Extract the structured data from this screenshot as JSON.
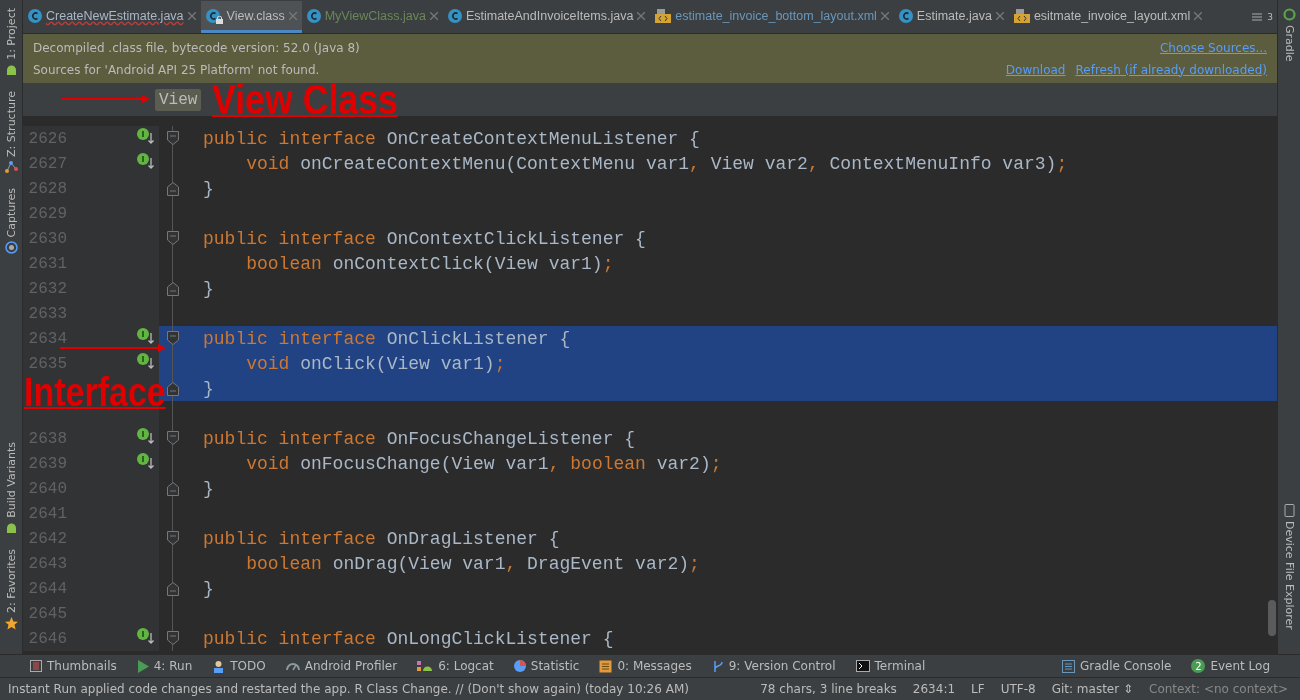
{
  "tabs": [
    {
      "label": "CreateNewEstimate.java",
      "kind": "class",
      "selected": false,
      "error": true,
      "locked": false,
      "color": "#a9b7c6"
    },
    {
      "label": "View.class",
      "kind": "class",
      "selected": true,
      "error": false,
      "locked": true,
      "color": "#bbbbbb"
    },
    {
      "label": "MyViewClass.java",
      "kind": "class",
      "selected": false,
      "error": false,
      "locked": false,
      "color": "#6a8759"
    },
    {
      "label": "EstimateAndInvoiceItems.java",
      "kind": "class",
      "selected": false,
      "error": false,
      "locked": false,
      "color": "#bbbbbb"
    },
    {
      "label": "estimate_invoice_bottom_layout.xml",
      "kind": "xml",
      "selected": false,
      "error": false,
      "locked": false,
      "color": "#6897bb"
    },
    {
      "label": "Estimate.java",
      "kind": "class",
      "selected": false,
      "error": false,
      "locked": false,
      "color": "#bbbbbb"
    },
    {
      "label": "esitmate_invoice_layout.xml",
      "kind": "xml",
      "selected": false,
      "error": false,
      "locked": false,
      "color": "#bbbbbb"
    }
  ],
  "tab_overflow": "3",
  "left_tool_windows": [
    {
      "label": "1: Project",
      "kind": "android"
    },
    {
      "label": "Z: Structure",
      "kind": "structure"
    },
    {
      "label": "Captures",
      "kind": "camera"
    },
    {
      "label": "Build Variants",
      "kind": "android"
    },
    {
      "label": "2: Favorites",
      "kind": "star"
    }
  ],
  "right_tool_windows": [
    {
      "label": "Gradle",
      "kind": "gradle"
    },
    {
      "label": "Device File Explorer",
      "kind": "phone"
    }
  ],
  "banner": {
    "lines": [
      {
        "text": "Decompiled .class file, bytecode version: 52.0 (Java 8)",
        "links": [
          "Choose Sources..."
        ]
      },
      {
        "text": "Sources for 'Android API 25 Platform' not found.",
        "links": [
          "Download",
          "Refresh (if already downloaded)"
        ]
      }
    ]
  },
  "breadcrumb": "View",
  "annotations": [
    {
      "text": "View Class",
      "kind": "title"
    },
    {
      "text": "Interface",
      "kind": "label"
    }
  ],
  "code_lines": [
    {
      "number": "2626",
      "implemented": true,
      "kind": "fold_start",
      "selected": false,
      "tokens": [
        {
          "kind": "keyword",
          "text": "public interface "
        },
        {
          "kind": "name",
          "text": "OnCreateContextMenuListener {"
        }
      ]
    },
    {
      "number": "2627",
      "implemented": true,
      "kind": "plain",
      "selected": false,
      "tokens": [
        {
          "kind": "keyword",
          "text": "    void "
        },
        {
          "kind": "name",
          "text": "onCreateContextMenu(ContextMenu var1"
        },
        {
          "kind": "keyword",
          "text": ", "
        },
        {
          "kind": "name",
          "text": "View var2"
        },
        {
          "kind": "keyword",
          "text": ", "
        },
        {
          "kind": "name",
          "text": "ContextMenuInfo var3)"
        },
        {
          "kind": "keyword",
          "text": ";"
        }
      ]
    },
    {
      "number": "2628",
      "implemented": false,
      "kind": "fold_end",
      "selected": false,
      "tokens": [
        {
          "kind": "name",
          "text": "}"
        }
      ]
    },
    {
      "number": "2629",
      "implemented": false,
      "kind": "plain",
      "selected": false
    },
    {
      "number": "2630",
      "implemented": false,
      "kind": "fold_start",
      "selected": false,
      "tokens": [
        {
          "kind": "keyword",
          "text": "public interface "
        },
        {
          "kind": "name",
          "text": "OnContextClickListener {"
        }
      ]
    },
    {
      "number": "2631",
      "implemented": false,
      "kind": "plain",
      "selected": false,
      "tokens": [
        {
          "kind": "keyword",
          "text": "    boolean "
        },
        {
          "kind": "name",
          "text": "onContextClick(View var1)"
        },
        {
          "kind": "keyword",
          "text": ";"
        }
      ]
    },
    {
      "number": "2632",
      "implemented": false,
      "kind": "fold_end",
      "selected": false,
      "tokens": [
        {
          "kind": "name",
          "text": "}"
        }
      ]
    },
    {
      "number": "2633",
      "implemented": false,
      "kind": "plain",
      "selected": false
    },
    {
      "number": "2634",
      "implemented": true,
      "kind": "fold_start",
      "selected": true,
      "tokens": [
        {
          "kind": "keyword",
          "text": "public interface "
        },
        {
          "kind": "name",
          "text": "OnClickListener {"
        }
      ]
    },
    {
      "number": "2635",
      "implemented": true,
      "kind": "plain",
      "selected": true,
      "tokens": [
        {
          "kind": "keyword",
          "text": "    void "
        },
        {
          "kind": "name",
          "text": "onClick(View var1)"
        },
        {
          "kind": "keyword",
          "text": ";"
        }
      ]
    },
    {
      "implemented": false,
      "kind": "fold_end",
      "selected": true,
      "tokens": [
        {
          "kind": "name",
          "text": "}"
        }
      ]
    },
    {
      "implemented": false,
      "kind": "plain",
      "selected": false
    },
    {
      "number": "2638",
      "implemented": true,
      "kind": "fold_start",
      "selected": false,
      "tokens": [
        {
          "kind": "keyword",
          "text": "public interface "
        },
        {
          "kind": "name",
          "text": "OnFocusChangeListener {"
        }
      ]
    },
    {
      "number": "2639",
      "implemented": true,
      "kind": "plain",
      "selected": false,
      "tokens": [
        {
          "kind": "keyword",
          "text": "    void "
        },
        {
          "kind": "name",
          "text": "onFocusChange(View var1"
        },
        {
          "kind": "keyword",
          "text": ", boolean "
        },
        {
          "kind": "name",
          "text": "var2)"
        },
        {
          "kind": "keyword",
          "text": ";"
        }
      ]
    },
    {
      "number": "2640",
      "implemented": false,
      "kind": "fold_end",
      "selected": false,
      "tokens": [
        {
          "kind": "name",
          "text": "}"
        }
      ]
    },
    {
      "number": "2641",
      "implemented": false,
      "kind": "plain",
      "selected": false
    },
    {
      "number": "2642",
      "implemented": false,
      "kind": "fold_start",
      "selected": false,
      "tokens": [
        {
          "kind": "keyword",
          "text": "public interface "
        },
        {
          "kind": "name",
          "text": "OnDragListener {"
        }
      ]
    },
    {
      "number": "2643",
      "implemented": false,
      "kind": "plain",
      "selected": false,
      "tokens": [
        {
          "kind": "keyword",
          "text": "    boolean "
        },
        {
          "kind": "name",
          "text": "onDrag(View var1"
        },
        {
          "kind": "keyword",
          "text": ", "
        },
        {
          "kind": "name",
          "text": "DragEvent var2)"
        },
        {
          "kind": "keyword",
          "text": ";"
        }
      ]
    },
    {
      "number": "2644",
      "implemented": false,
      "kind": "fold_end",
      "selected": false,
      "tokens": [
        {
          "kind": "name",
          "text": "}"
        }
      ]
    },
    {
      "number": "2645",
      "implemented": false,
      "kind": "plain",
      "selected": false
    },
    {
      "number": "2646",
      "implemented": true,
      "kind": "fold_start",
      "selected": false,
      "tokens": [
        {
          "kind": "keyword",
          "text": "public interface "
        },
        {
          "kind": "name",
          "text": "OnLongClickListener {"
        }
      ]
    }
  ],
  "bottom_tools": [
    {
      "label": "Thumbnails",
      "kind": "thumbs"
    },
    {
      "label": "4: Run",
      "kind": "run"
    },
    {
      "label": "TODO",
      "kind": "todo"
    },
    {
      "label": "Android Profiler",
      "kind": "gauge"
    },
    {
      "label": "6: Logcat",
      "kind": "logcat"
    },
    {
      "label": "Statistic",
      "kind": "pie"
    },
    {
      "label": "0: Messages",
      "kind": "messages"
    },
    {
      "label": "9: Version Control",
      "kind": "vcs"
    },
    {
      "label": "Terminal",
      "kind": "terminal"
    }
  ],
  "bottom_tools_right": [
    {
      "label": "Gradle Console",
      "kind": "console"
    },
    {
      "label": "Event Log",
      "kind": "badge",
      "badge": "2"
    }
  ],
  "status_bar": {
    "message": "Instant Run applied code changes and restarted the app. R Class Change. // (Don't show again) (today 10:26 AM)",
    "items": [
      "78 chars, 3 line breaks",
      "2634:1",
      "LF",
      "UTF-8",
      "Git: master ⇕",
      "Context: <no context>"
    ]
  }
}
